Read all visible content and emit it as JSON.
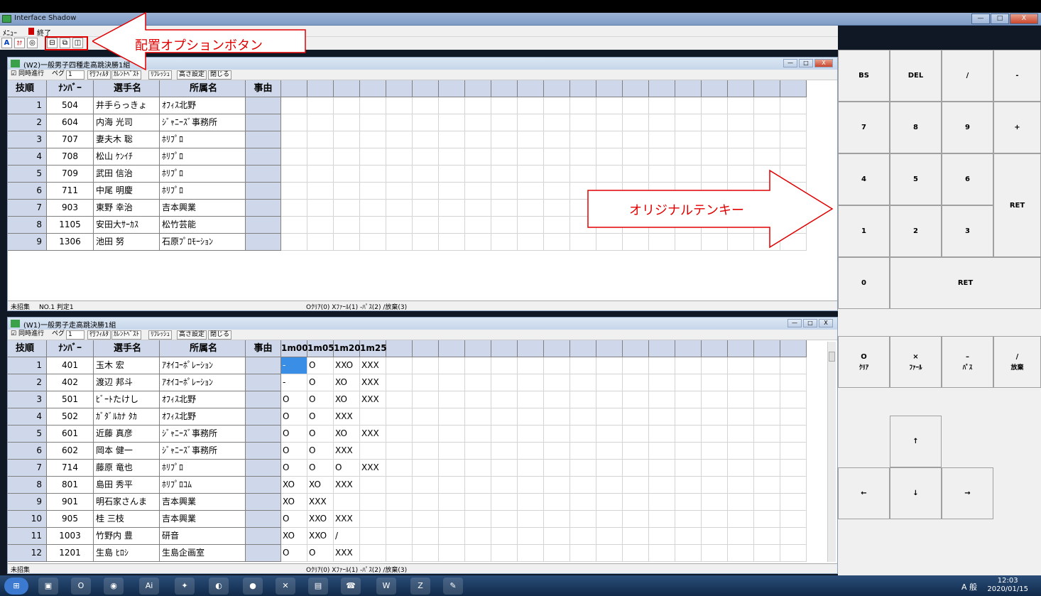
{
  "app": {
    "title": "Interface Shadow"
  },
  "window_controls": {
    "minimize": "—",
    "maximize": "□",
    "close": "X"
  },
  "menubar": {
    "menu": "ﾒﾆｭｰ",
    "exit": "終了"
  },
  "annotations": {
    "layout_option_button": "配置オプションボタン",
    "original_tenkey": "オリジナルテンキー"
  },
  "toolbar_labels": [
    "同時進行",
    "ペグ",
    "1",
    "行ﾌｨﾙﾀ",
    "ｶﾚﾝﾄﾍﾞｽﾄ",
    "ﾘﾌﾚｯｼｭ",
    "高さ設定",
    "閉じる"
  ],
  "columns": {
    "order": "技順",
    "number": "ﾅﾝﾊﾞｰ",
    "name": "選手名",
    "team": "所属名",
    "reason": "事由"
  },
  "w2": {
    "title": "(W2)一般男子四種走高跳決勝1組",
    "rows": [
      {
        "no": "1",
        "num": "504",
        "name": "井手らっきょ",
        "team": "ｵﾌｨｽ北野"
      },
      {
        "no": "2",
        "num": "604",
        "name": "内海 光司",
        "team": "ｼﾞｬﾆｰｽﾞ事務所"
      },
      {
        "no": "3",
        "num": "707",
        "name": "妻夫木 聡",
        "team": "ﾎﾘﾌﾟﾛ"
      },
      {
        "no": "4",
        "num": "708",
        "name": "松山 ｹﾝｲﾁ",
        "team": "ﾎﾘﾌﾟﾛ"
      },
      {
        "no": "5",
        "num": "709",
        "name": "武田 信治",
        "team": "ﾎﾘﾌﾟﾛ"
      },
      {
        "no": "6",
        "num": "711",
        "name": "中尾 明慶",
        "team": "ﾎﾘﾌﾟﾛ"
      },
      {
        "no": "7",
        "num": "903",
        "name": "東野 幸治",
        "team": "吉本興業"
      },
      {
        "no": "8",
        "num": "1105",
        "name": "安田大ｻｰｶｽ",
        "team": "松竹芸能"
      },
      {
        "no": "9",
        "num": "1306",
        "name": "池田 努",
        "team": "石原ﾌﾟﾛﾓｰｼｮﾝ"
      }
    ],
    "status_left": "未招集",
    "status_mid": "NO.1 判定1",
    "status_hint": "Oｸﾘｱ(0) Xﾌｧｰﾙ(1) -ﾊﾟｽ(2) /放棄(3)"
  },
  "w1": {
    "title": "(W1)一般男子走高跳決勝1組",
    "heights": [
      "1m00",
      "1m05",
      "1m20",
      "1m25"
    ],
    "rows": [
      {
        "no": "1",
        "num": "401",
        "name": "玉木 宏",
        "team": "ｱｵｲｺｰﾎﾟﾚｰｼｮﾝ",
        "marks": [
          "-",
          "O",
          "XXO",
          "XXX"
        ]
      },
      {
        "no": "2",
        "num": "402",
        "name": "渡辺 邦斗",
        "team": "ｱｵｲｺｰﾎﾟﾚｰｼｮﾝ",
        "marks": [
          "-",
          "O",
          "XO",
          "XXX"
        ]
      },
      {
        "no": "3",
        "num": "501",
        "name": "ﾋﾞｰﾄたけし",
        "team": "ｵﾌｨｽ北野",
        "marks": [
          "O",
          "O",
          "XO",
          "XXX"
        ]
      },
      {
        "no": "4",
        "num": "502",
        "name": "ｶﾞﾀﾞﾙｶﾅ ﾀｶ",
        "team": "ｵﾌｨｽ北野",
        "marks": [
          "O",
          "O",
          "XXX",
          ""
        ]
      },
      {
        "no": "5",
        "num": "601",
        "name": "近藤 真彦",
        "team": "ｼﾞｬﾆｰｽﾞ事務所",
        "marks": [
          "O",
          "O",
          "XO",
          "XXX"
        ]
      },
      {
        "no": "6",
        "num": "602",
        "name": "岡本 健一",
        "team": "ｼﾞｬﾆｰｽﾞ事務所",
        "marks": [
          "O",
          "O",
          "XXX",
          ""
        ]
      },
      {
        "no": "7",
        "num": "714",
        "name": "藤原 竜也",
        "team": "ﾎﾘﾌﾟﾛ",
        "marks": [
          "O",
          "O",
          "O",
          "XXX"
        ]
      },
      {
        "no": "8",
        "num": "801",
        "name": "島田 秀平",
        "team": "ﾎﾘﾌﾟﾛｺﾑ",
        "marks": [
          "XO",
          "XO",
          "XXX",
          ""
        ]
      },
      {
        "no": "9",
        "num": "901",
        "name": "明石家さんま",
        "team": "吉本興業",
        "marks": [
          "XO",
          "XXX",
          "",
          ""
        ]
      },
      {
        "no": "10",
        "num": "905",
        "name": "桂 三枝",
        "team": "吉本興業",
        "marks": [
          "O",
          "XXO",
          "XXX",
          ""
        ]
      },
      {
        "no": "11",
        "num": "1003",
        "name": "竹野内 豊",
        "team": "研音",
        "marks": [
          "XO",
          "XXO",
          "/",
          ""
        ]
      },
      {
        "no": "12",
        "num": "1201",
        "name": "生島 ﾋﾛｼ",
        "team": "生島企画室",
        "marks": [
          "O",
          "O",
          "XXX",
          ""
        ]
      }
    ],
    "status_left": "未招集",
    "status_hint": "Oｸﾘｱ(0) Xﾌｧｰﾙ(1) -ﾊﾟｽ(2) /放棄(3)"
  },
  "keypad": {
    "bs": "BS",
    "del": "DEL",
    "slash": "/",
    "minus": "-",
    "k7": "7",
    "k8": "8",
    "k9": "9",
    "plus": "+",
    "k4": "4",
    "k5": "5",
    "k6": "6",
    "ret": "RET",
    "k1": "1",
    "k2": "2",
    "k3": "3",
    "k0": "0",
    "ret2": "RET",
    "clear_sym": "O",
    "clear": "ｸﾘｱ",
    "foul_sym": "×",
    "foul": "ﾌｧｰﾙ",
    "pass_sym": "–",
    "pass": "ﾊﾟｽ",
    "abandon_sym": "/",
    "abandon": "放棄",
    "up": "↑",
    "left": "←",
    "down": "↓",
    "right": "→"
  },
  "taskbar": {
    "clock_time": "12:03",
    "clock_date": "2020/01/15",
    "ime": "A 般"
  }
}
